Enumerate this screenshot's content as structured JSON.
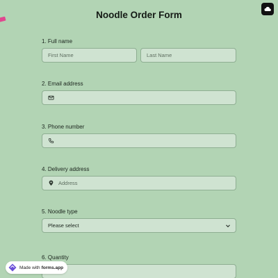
{
  "form": {
    "title": "Noodle Order Form",
    "questions": [
      {
        "label": "1.  Full name",
        "fields": [
          {
            "placeholder": "First Name"
          },
          {
            "placeholder": "Last Name"
          }
        ]
      },
      {
        "label": "2. Email address",
        "icon": "envelope-icon"
      },
      {
        "label": "3. Phone number",
        "icon": "phone-icon"
      },
      {
        "label": "4. Delivery address",
        "icon": "location-pin-icon",
        "placeholder": "Address"
      },
      {
        "label": "5. Noodle type",
        "value": "Please select"
      },
      {
        "label": "6. Quantity"
      }
    ]
  },
  "badge": {
    "prefix": "Made with",
    "brand": "forms.app"
  },
  "colors": {
    "background": "#b2d4b4",
    "field_bg": "#cfe3d1",
    "field_border": "#8eae92",
    "accent": "#e0478f"
  }
}
